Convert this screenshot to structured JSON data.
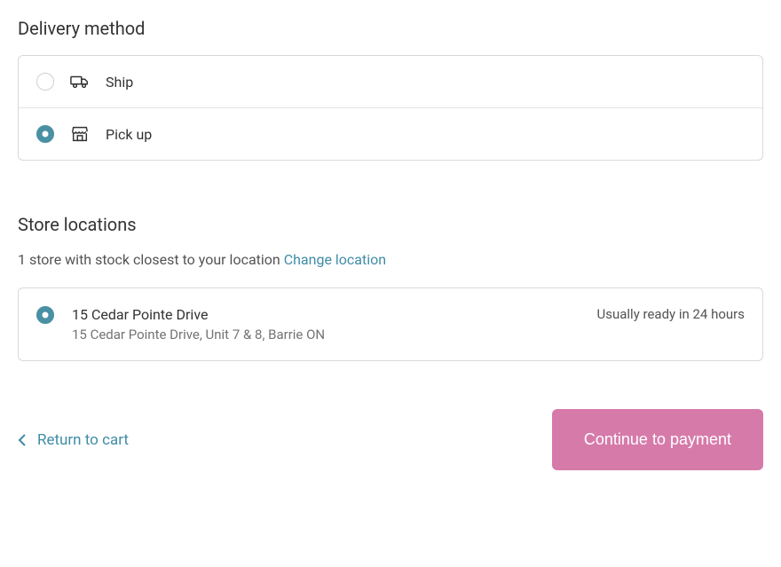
{
  "delivery": {
    "heading": "Delivery method",
    "options": [
      {
        "label": "Ship",
        "selected": false
      },
      {
        "label": "Pick up",
        "selected": true
      }
    ]
  },
  "stores": {
    "heading": "Store locations",
    "subtext": "1 store with stock closest to your location",
    "change_link": "Change location",
    "location": {
      "name": "15 Cedar Pointe Drive",
      "address": "15 Cedar Pointe Drive, Unit 7 & 8, Barrie ON",
      "ready_text": "Usually ready in 24 hours",
      "selected": true
    }
  },
  "footer": {
    "return_label": "Return to cart",
    "continue_label": "Continue to payment"
  }
}
